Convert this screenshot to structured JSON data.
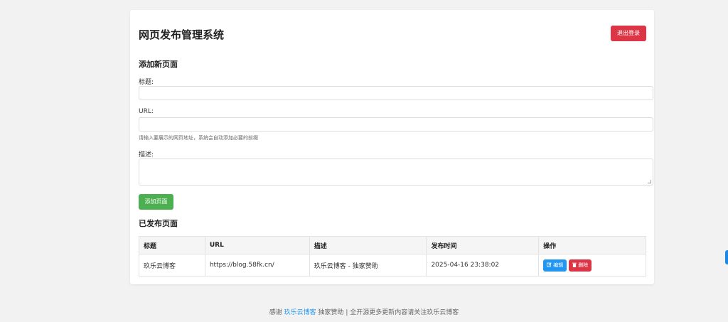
{
  "header": {
    "title": "网页发布管理系统",
    "logout_label": "退出登录"
  },
  "form": {
    "section_title": "添加新页面",
    "title_label": "标题:",
    "title_value": "",
    "url_label": "URL:",
    "url_value": "",
    "url_help": "请输入要展示的网页地址，系统会自动添加必要的前缀",
    "desc_label": "描述:",
    "desc_value": "",
    "submit_label": "添加页面"
  },
  "published": {
    "section_title": "已发布页面",
    "columns": [
      "标题",
      "URL",
      "描述",
      "发布时间",
      "操作"
    ],
    "rows": [
      {
        "title": "玖乐云博客",
        "url": "https://blog.58fk.cn/",
        "description": "玖乐云博客 - 独家赞助",
        "published_at": "2025-04-16 23:38:02",
        "edit_label": "编辑",
        "delete_label": "删除"
      }
    ]
  },
  "footer": {
    "prefix": "感谢",
    "link_text": "玖乐云博客",
    "suffix": "独家赞助 | 全开源更多更新内容请关注玖乐云博客"
  },
  "colors": {
    "danger": "#dc3545",
    "success": "#4caf50",
    "primary": "#2196f3"
  }
}
